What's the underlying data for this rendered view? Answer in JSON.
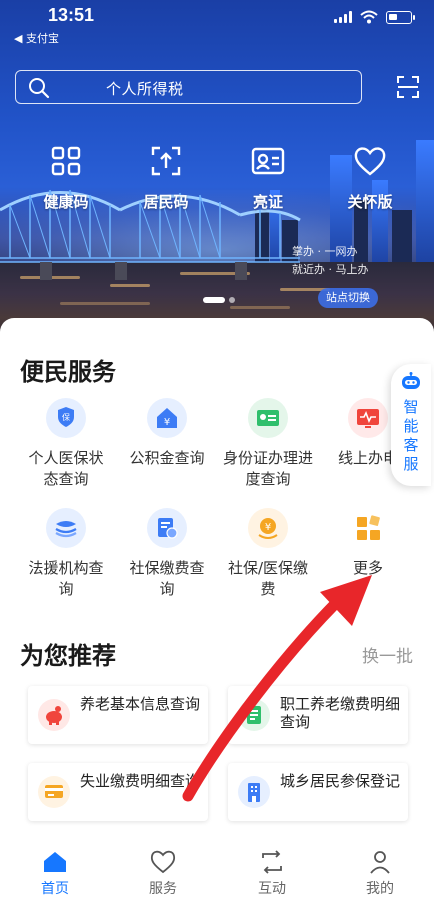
{
  "status_bar": {
    "time": "13:51",
    "back_app": "◀ 支付宝"
  },
  "search": {
    "placeholder": "个人所得税"
  },
  "quick_entries": [
    {
      "label": "健康码",
      "icon": "qr-grid-icon"
    },
    {
      "label": "居民码",
      "icon": "upload-frame-icon"
    },
    {
      "label": "亮证",
      "icon": "id-card-icon"
    },
    {
      "label": "关怀版",
      "icon": "heart-icon"
    }
  ],
  "hero": {
    "tag_line1": "掌办 · 一网办",
    "tag_line2": "就近办 · 马上办",
    "site_switch": "站点切换"
  },
  "convenience": {
    "title": "便民服务",
    "items": [
      {
        "label": "个人医保状态查询",
        "icon": "shield-hand-icon"
      },
      {
        "label": "公积金查询",
        "icon": "house-yen-icon"
      },
      {
        "label": "身份证办理进度查询",
        "icon": "id-card-icon"
      },
      {
        "label": "线上办电",
        "icon": "monitor-pulse-icon"
      },
      {
        "label": "法援机构查询",
        "icon": "layers-icon"
      },
      {
        "label": "社保缴费查询",
        "icon": "document-coin-icon"
      },
      {
        "label": "社保/医保缴费",
        "icon": "yen-coin-icon"
      },
      {
        "label": "更多",
        "icon": "apps-grid-icon"
      }
    ]
  },
  "assistant": {
    "label": "智能客服"
  },
  "recommend": {
    "title": "为您推荐",
    "refresh": "换一批",
    "items": [
      {
        "label": "养老基本信息查询",
        "icon": "piggy-icon"
      },
      {
        "label": "职工养老缴费明细查询",
        "icon": "list-icon"
      },
      {
        "label": "失业缴费明细查询",
        "icon": "card-icon"
      },
      {
        "label": "城乡居民参保登记",
        "icon": "building-icon"
      }
    ]
  },
  "tabbar": [
    {
      "label": "首页",
      "icon": "home-icon",
      "active": true
    },
    {
      "label": "服务",
      "icon": "heart-outline-icon",
      "active": false
    },
    {
      "label": "互动",
      "icon": "exchange-icon",
      "active": false
    },
    {
      "label": "我的",
      "icon": "user-icon",
      "active": false
    }
  ],
  "colors": {
    "accent": "#1677ff",
    "arrow": "#e8262a",
    "hero": "#2153c8"
  }
}
